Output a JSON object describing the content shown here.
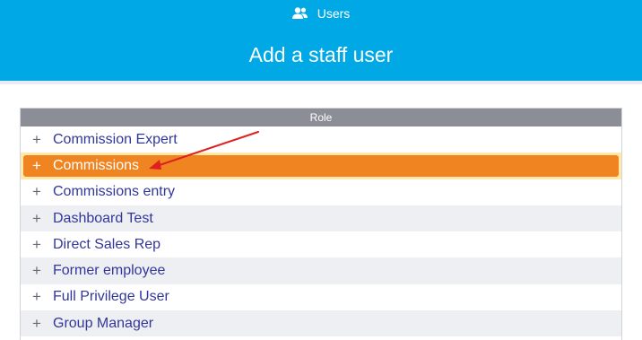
{
  "header": {
    "nav_label": "Users",
    "title": "Add a staff user",
    "background": "#00a9e6"
  },
  "table": {
    "column_header": "Role",
    "rows": [
      {
        "label": "Commission Expert",
        "icon": "plus-icon"
      },
      {
        "label": "Commissions",
        "icon": "plus-icon",
        "selected": true
      },
      {
        "label": "Commissions entry",
        "icon": "plus-icon"
      },
      {
        "label": "Dashboard Test",
        "icon": "plus-icon"
      },
      {
        "label": "Direct Sales Rep",
        "icon": "plus-icon"
      },
      {
        "label": "Former employee",
        "icon": "plus-icon"
      },
      {
        "label": "Full Privilege User",
        "icon": "plus-icon"
      },
      {
        "label": "Group Manager",
        "icon": "plus-icon"
      }
    ],
    "plus_symbol": "+",
    "selected_color": "#ef8421"
  },
  "annotation": {
    "type": "arrow",
    "color": "#e02020",
    "points_to": "Commissions"
  }
}
